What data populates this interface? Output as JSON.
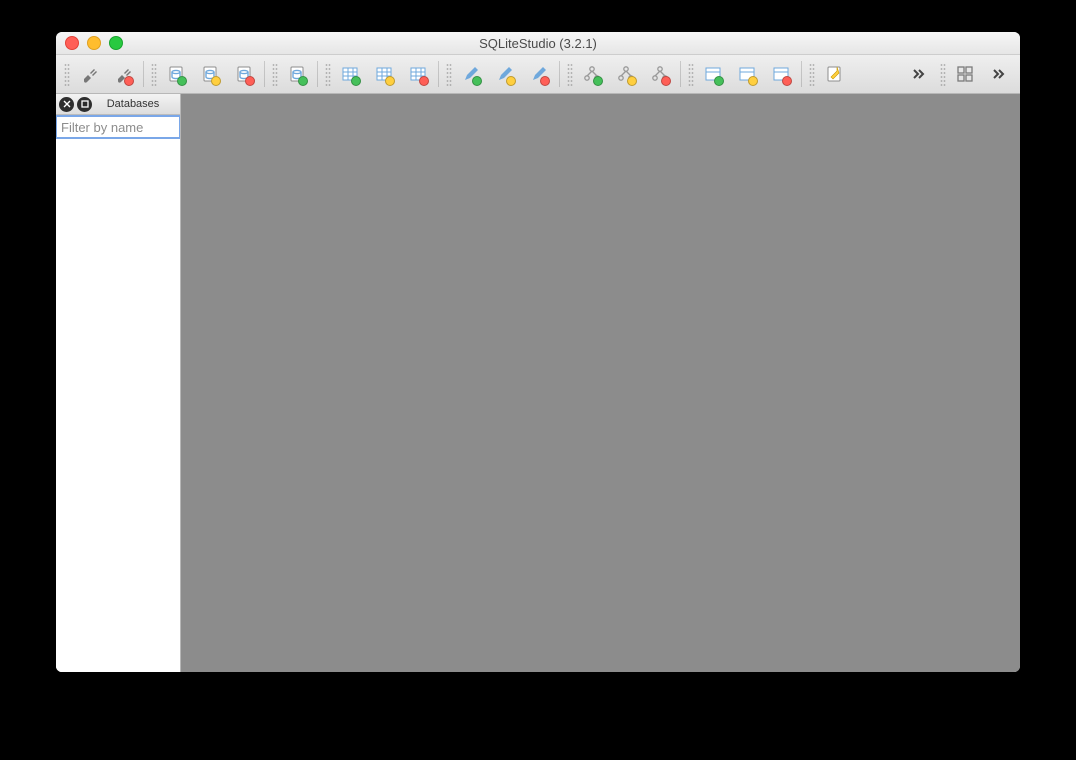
{
  "window": {
    "title": "SQLiteStudio (3.2.1)"
  },
  "sidebar": {
    "tab_label": "Databases",
    "filter_placeholder": "Filter by name"
  },
  "toolbar": {
    "groups": [
      [
        "connect",
        "disconnect"
      ],
      [
        "db-add",
        "db-edit",
        "db-remove"
      ],
      [
        "db-import"
      ],
      [
        "table-add",
        "table-edit",
        "table-remove"
      ],
      [
        "index-add",
        "index-edit",
        "index-remove"
      ],
      [
        "trigger-add",
        "trigger-edit",
        "trigger-remove"
      ],
      [
        "view-add",
        "view-edit",
        "view-remove"
      ],
      [
        "sql-editor"
      ]
    ],
    "overflow1": "overflow",
    "windows": "window-layout",
    "overflow2": "overflow"
  }
}
